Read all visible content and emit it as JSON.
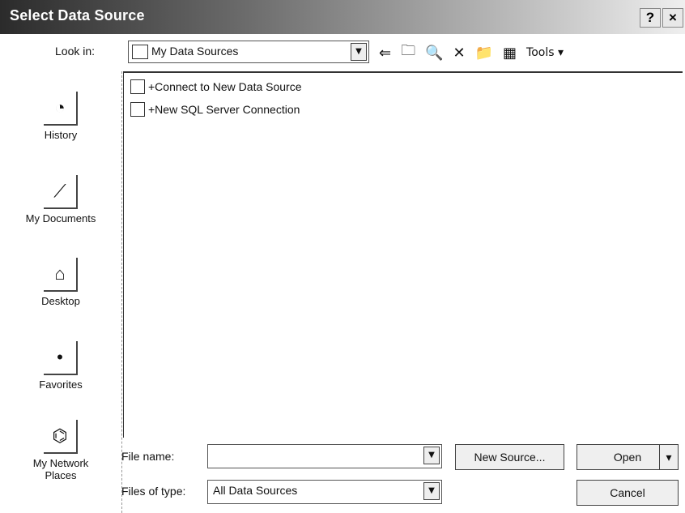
{
  "dialog": {
    "title": "Select Data Source"
  },
  "titlebar": {
    "help_label": "?",
    "close_label": "×"
  },
  "lookin": {
    "label": "Look in:",
    "value": "My Data Sources"
  },
  "toolbar": {
    "back_icon": "back-arrow-icon",
    "up_folder_icon": "up-folder-icon",
    "search_web_icon": "search-web-icon",
    "delete_icon": "delete-icon",
    "new_folder_icon": "new-folder-icon",
    "views_icon": "views-icon",
    "tools_label": "Tools"
  },
  "places": [
    {
      "label": "History",
      "icon": "history-icon"
    },
    {
      "label": "My Documents",
      "icon": "my-documents-icon"
    },
    {
      "label": "Desktop",
      "icon": "desktop-icon"
    },
    {
      "label": "Favorites",
      "icon": "favorites-icon"
    },
    {
      "label": "My Network Places",
      "icon": "network-places-icon"
    }
  ],
  "files": [
    {
      "name": "+Connect to New Data Source"
    },
    {
      "name": "+New SQL Server Connection"
    }
  ],
  "filename": {
    "label": "File name:",
    "value": ""
  },
  "filetype": {
    "label": "Files of type:",
    "value": "All Data Sources"
  },
  "buttons": {
    "new_source": "New Source...",
    "open": "Open",
    "cancel": "Cancel"
  }
}
